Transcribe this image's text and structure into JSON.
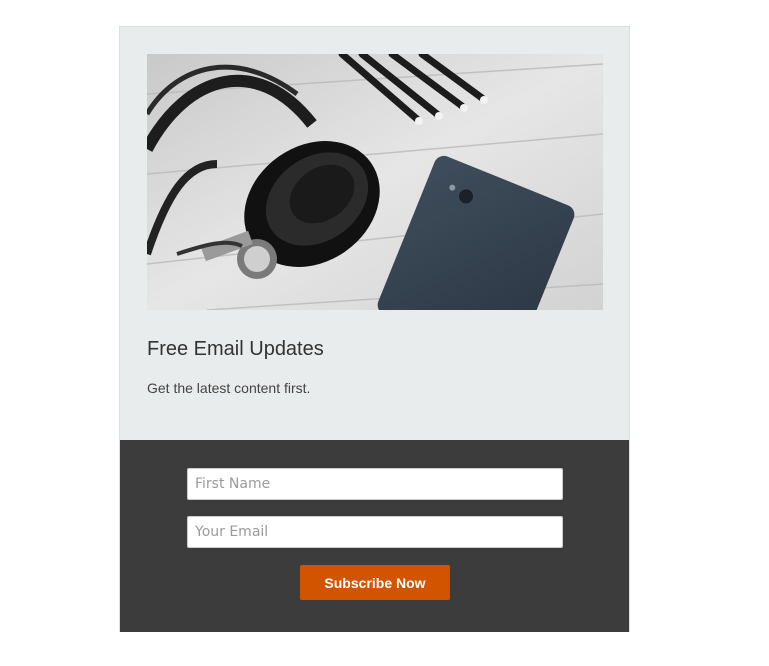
{
  "optin": {
    "image_alt": "Headphones and smartphone on a white wooden desk",
    "title": "Free Email Updates",
    "subtitle": "Get the latest content first.",
    "first_name_placeholder": "First Name",
    "email_placeholder": "Your Email",
    "subscribe_label": "Subscribe Now"
  },
  "colors": {
    "panel_background": "#e9ecec",
    "form_background": "#3c3c3c",
    "button": "#d35400"
  }
}
